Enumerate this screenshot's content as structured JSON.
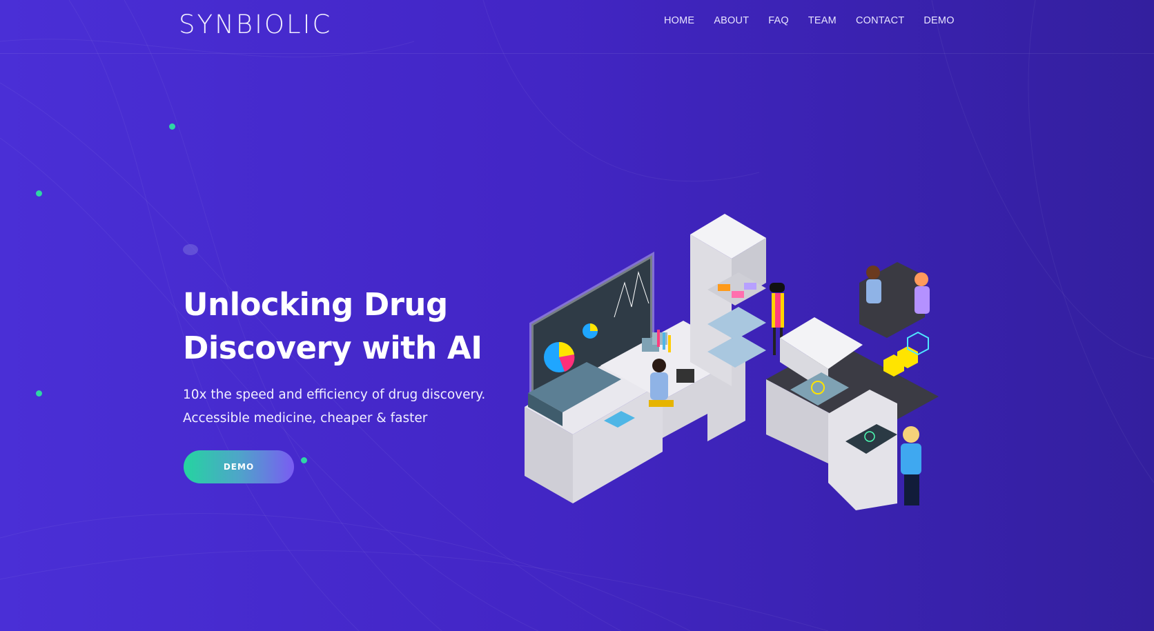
{
  "header": {
    "logo": "SYNBIOLIC",
    "nav": [
      "HOME",
      "ABOUT",
      "FAQ",
      "TEAM",
      "CONTACT",
      "DEMO"
    ]
  },
  "hero": {
    "title_line1": "Unlocking Drug",
    "title_line2": "Discovery with AI",
    "subtitle_line1": "10x the speed and efficiency of drug discovery.",
    "subtitle_line2": "Accessible medicine, cheaper & faster",
    "cta_label": "DEMO"
  },
  "illustration": {
    "name": "isometric-drug-discovery-lab-illustration"
  },
  "colors": {
    "background": "#4326c6",
    "accent_green": "#2fd6a5",
    "button_gradient_start": "#25d4a0",
    "button_gradient_end": "#7a5cf2"
  }
}
